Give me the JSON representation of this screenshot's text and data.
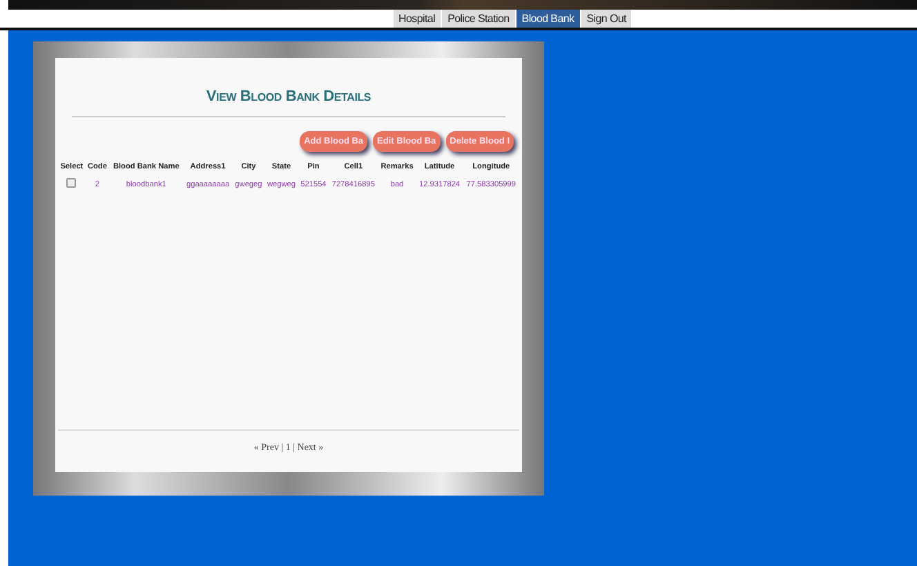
{
  "nav": [
    {
      "label": "Hospital",
      "selected": false
    },
    {
      "label": "Police Station",
      "selected": false
    },
    {
      "label": "Blood Bank",
      "selected": true
    },
    {
      "label": "Sign Out",
      "selected": false
    }
  ],
  "heading": "View Blood Bank Details",
  "buttons": [
    "Add Blood Ba",
    "Edit Blood Ba",
    "Delete Blood I"
  ],
  "table": {
    "columns": [
      "Select",
      "Code",
      "Blood Bank Name",
      "Address1",
      "City",
      "State",
      "Pin",
      "Cell1",
      "Remarks",
      "Latitude",
      "Longitude"
    ],
    "rows": [
      {
        "checked": false,
        "cells": [
          "",
          "2",
          "bloodbank1",
          "ggaaaaaaaa",
          "gwegeg",
          "wegweg",
          "521554",
          "7278416895",
          "bad",
          "12.9317824",
          "77.583305999"
        ]
      }
    ]
  },
  "pager": "« Prev | 1 | Next »"
}
